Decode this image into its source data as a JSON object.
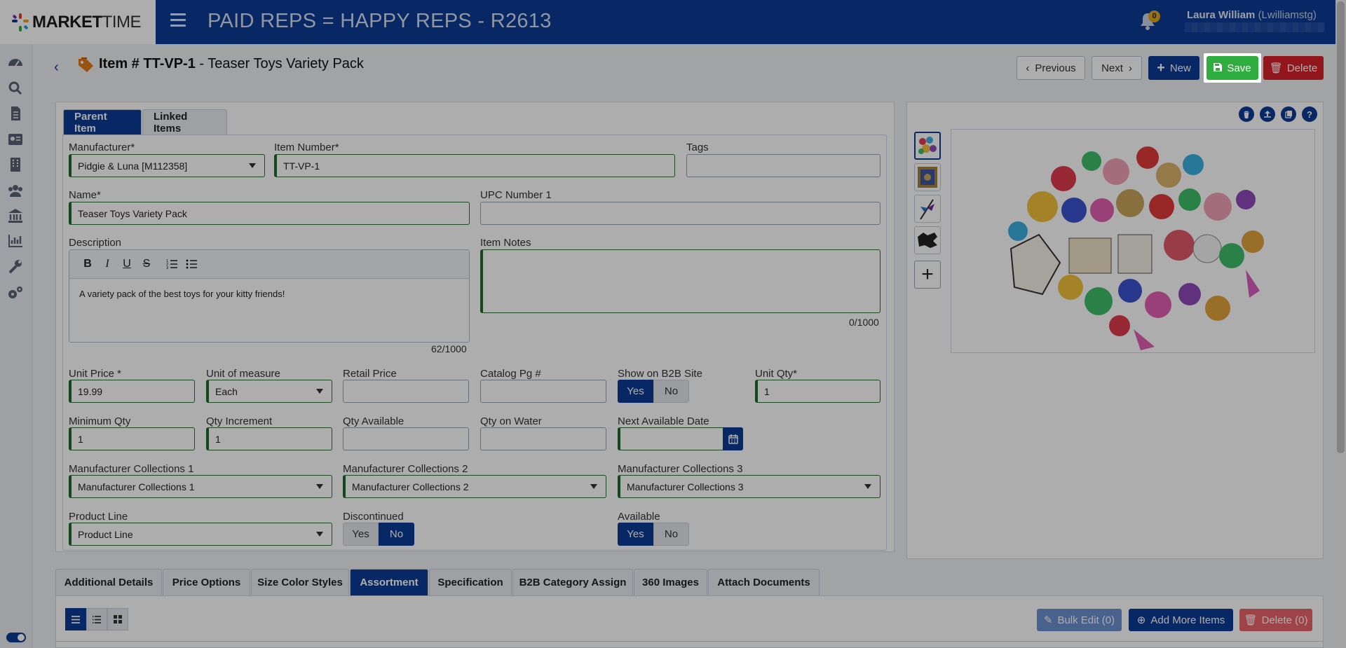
{
  "header": {
    "logo_bold": "MARKET",
    "logo_thin": "TIME",
    "app_title": "PAID REPS = HAPPY REPS - R2613",
    "notification_count": "0",
    "user_name": "Laura William",
    "user_login": "(Lwilliamstg)"
  },
  "item": {
    "title_prefix": "Item # TT-VP-1",
    "title_separator": " - ",
    "title_name": "Teaser Toys Variety Pack"
  },
  "actions": {
    "previous": "Previous",
    "next": "Next",
    "new": "New",
    "save": "Save",
    "delete": "Delete"
  },
  "tabs": {
    "parent": "Parent Item",
    "linked": "Linked Items"
  },
  "form": {
    "manufacturer_label": "Manufacturer*",
    "manufacturer_value": "Pidgie & Luna [M112358]",
    "item_number_label": "Item Number*",
    "item_number_value": "TT-VP-1",
    "tags_label": "Tags",
    "name_label": "Name*",
    "name_value": "Teaser Toys Variety Pack",
    "upc_label": "UPC Number 1",
    "description_label": "Description",
    "description_value": "A variety pack of the best toys for your kitty friends!",
    "description_counter": "62/1000",
    "notes_label": "Item Notes",
    "notes_counter": "0/1000",
    "unit_price_label": "Unit Price *",
    "unit_price_value": "19.99",
    "uom_label": "Unit of measure",
    "uom_value": "Each",
    "retail_label": "Retail Price",
    "catalog_label": "Catalog Pg #",
    "b2b_label": "Show on B2B Site",
    "unit_qty_label": "Unit Qty*",
    "unit_qty_value": "1",
    "min_qty_label": "Minimum Qty",
    "min_qty_value": "1",
    "qty_inc_label": "Qty Increment",
    "qty_inc_value": "1",
    "qty_avail_label": "Qty Available",
    "qty_water_label": "Qty on Water",
    "next_date_label": "Next Available Date",
    "mc1_label": "Manufacturer Collections 1",
    "mc1_value": "Manufacturer Collections 1",
    "mc2_label": "Manufacturer Collections 2",
    "mc2_value": "Manufacturer Collections 2",
    "mc3_label": "Manufacturer Collections 3",
    "mc3_value": "Manufacturer Collections 3",
    "product_line_label": "Product Line",
    "product_line_value": "Product Line",
    "discontinued_label": "Discontinued",
    "available_label": "Available",
    "yes": "Yes",
    "no": "No"
  },
  "bottom_tabs": [
    "Additional Details",
    "Price Options",
    "Size Color Styles",
    "Assortment",
    "Specification",
    "B2B Category Assign",
    "360 Images",
    "Attach Documents"
  ],
  "bottom_actions": {
    "bulk_edit": "Bulk Edit (0)",
    "add_more": "Add More Items",
    "delete": "Delete (0)"
  },
  "colors": {
    "brand_blue": "#0b3b96",
    "save_green": "#2fae3f",
    "delete_red": "#d8232a",
    "required_green": "#1c6b2a"
  }
}
